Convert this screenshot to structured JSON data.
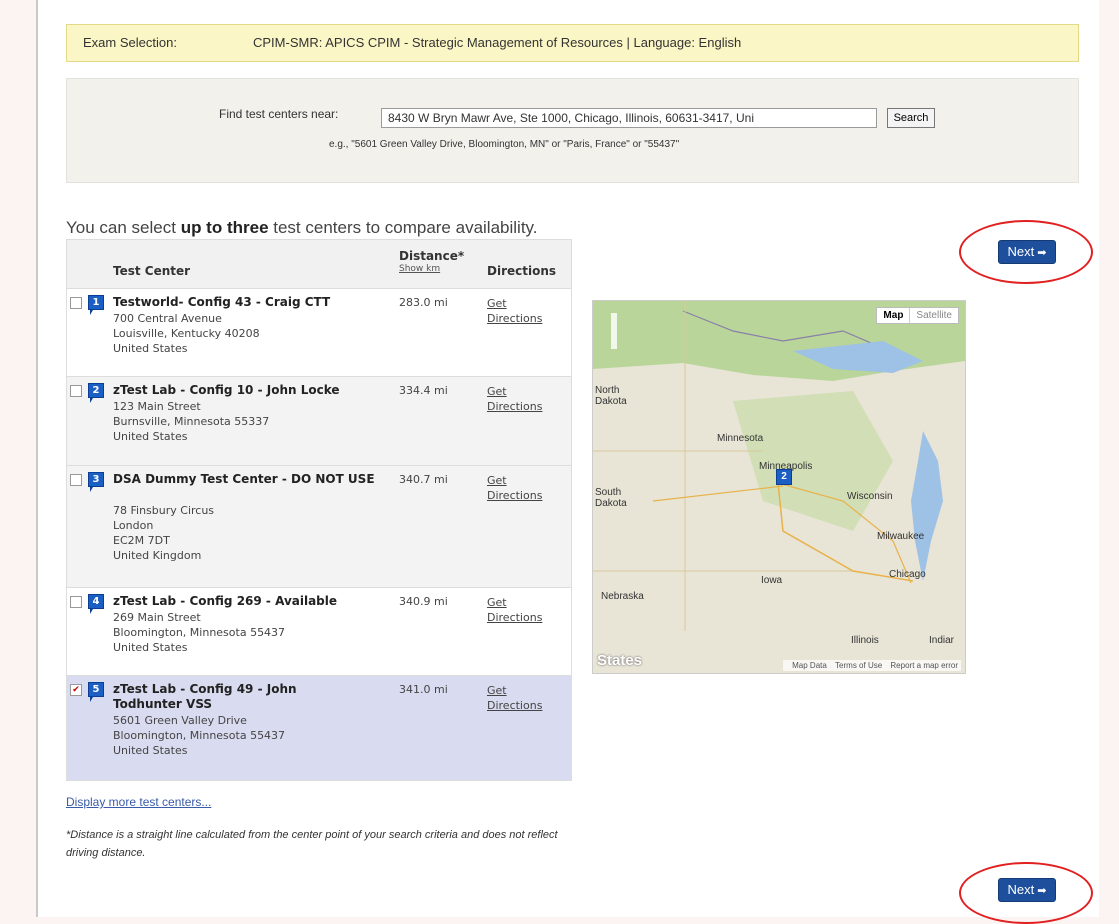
{
  "exam": {
    "label": "Exam Selection:",
    "value": "CPIM-SMR: APICS CPIM - Strategic Management of Resources | Language: English"
  },
  "search": {
    "label": "Find test centers near:",
    "value": "8430 W Bryn Mawr Ave, Ste 1000, Chicago, Illinois, 60631-3417, Uni",
    "button": "Search",
    "hint": "e.g., \"5601 Green Valley Drive, Bloomington, MN\" or \"Paris, France\" or \"55437\""
  },
  "intro": {
    "pre": "You can select ",
    "bold": "up to three",
    "post": " test centers to compare availability."
  },
  "table": {
    "col_center": "Test Center",
    "col_distance": "Distance*",
    "show_km": "Show km",
    "col_directions": "Directions",
    "rows": [
      {
        "num": "1",
        "name": "Testworld- Config 43 - Craig CTT",
        "address": [
          "700 Central Avenue",
          "Louisville, Kentucky 40208",
          "United States"
        ],
        "distance": "283.0 mi",
        "dir1": "Get",
        "dir2": "Directions",
        "checked": false
      },
      {
        "num": "2",
        "name": "zTest Lab - Config 10 - John Locke",
        "address": [
          "123 Main Street",
          "Burnsville, Minnesota 55337",
          "United States"
        ],
        "distance": "334.4 mi",
        "dir1": "Get",
        "dir2": "Directions",
        "checked": false
      },
      {
        "num": "3",
        "name": "DSA Dummy Test Center - DO NOT USE",
        "address": [
          "78 Finsbury Circus",
          "London",
          "EC2M 7DT",
          "United Kingdom"
        ],
        "distance": "340.7 mi",
        "dir1": "Get",
        "dir2": "Directions",
        "checked": false
      },
      {
        "num": "4",
        "name": "zTest Lab - Config 269 - Available",
        "address": [
          "269 Main Street",
          "Bloomington, Minnesota 55437",
          "United States"
        ],
        "distance": "340.9 mi",
        "dir1": "Get",
        "dir2": "Directions",
        "checked": false
      },
      {
        "num": "5",
        "name": "zTest Lab - Config 49 - John Todhunter VSS",
        "address": [
          "5601 Green Valley Drive",
          "Bloomington, Minnesota 55437",
          "United States"
        ],
        "distance": "341.0 mi",
        "dir1": "Get",
        "dir2": "Directions",
        "checked": true
      }
    ]
  },
  "map": {
    "btn_map": "Map",
    "btn_satellite": "Satellite",
    "labels": {
      "north_dakota": "North\nDakota",
      "south_dakota": "South\nDakota",
      "minnesota": "Minnesota",
      "minneapolis": "Minneapolis",
      "wisconsin": "Wisconsin",
      "milwaukee": "Milwaukee",
      "iowa": "Iowa",
      "chicago": "Chicago",
      "nebraska": "Nebraska",
      "illinois": "Illinois",
      "indiana": "Indiar",
      "states": "States"
    },
    "marker": "2",
    "footer_data": "Map Data",
    "footer_terms": "Terms of Use",
    "footer_report": "Report a map error"
  },
  "more_link": "Display more test centers...",
  "note": "*Distance is a straight line calculated from the center point of your search criteria and does not reflect driving distance.",
  "next_label": "Next",
  "colors": {
    "accent": "#1e4f9d",
    "highlight": "#e12020",
    "selected_row": "#d9dcf0"
  }
}
